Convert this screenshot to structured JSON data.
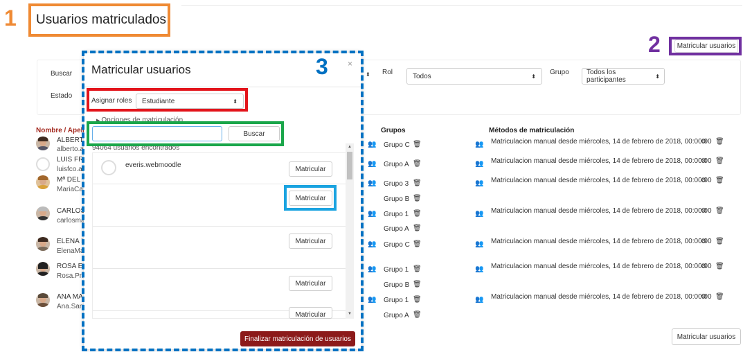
{
  "callouts": [
    "1",
    "2",
    "3"
  ],
  "page": {
    "title": "Usuarios matriculados"
  },
  "buttons": {
    "enrol_users_top": "Matricular usuarios",
    "enrol_users_bottom": "Matricular usuarios"
  },
  "filters": {
    "search_label": "Buscar",
    "status_label": "Estado",
    "role_label": "Rol",
    "role_value": "Todos",
    "group_label": "Grupo",
    "group_value": "Todos los participantes"
  },
  "table": {
    "headers": {
      "name": "Nombre / Apell",
      "groups": "Grupos",
      "methods": "Métodos de matriculación"
    },
    "rows": [
      {
        "name": "ALBERT",
        "email": "alberto.ar",
        "groups": [
          "Grupo C"
        ],
        "method": "Matriculacion manual desde miércoles, 14 de febrero de 2018, 00:00:00"
      },
      {
        "name": "LUIS FR",
        "email": "luisfco.ar",
        "groups": [
          "Grupo A"
        ],
        "method": "Matriculacion manual desde miércoles, 14 de febrero de 2018, 00:00:00"
      },
      {
        "name": "Mª DEL",
        "email": "MariaCa",
        "groups": [
          "Grupo 3",
          "Grupo B"
        ],
        "method": "Matriculacion manual desde miércoles, 14 de febrero de 2018, 00:00:00"
      },
      {
        "name": "CARLOS",
        "email": "carlosmai",
        "groups": [
          "Grupo 1",
          "Grupo A"
        ],
        "method": "Matriculacion manual desde miércoles, 14 de febrero de 2018, 00:00:00"
      },
      {
        "name": "ELENA I",
        "email": "ElenaMa",
        "groups": [
          "Grupo C"
        ],
        "method": "Matriculacion manual desde miércoles, 14 de febrero de 2018, 00:00:00"
      },
      {
        "name": "ROSA E",
        "email": "Rosa.Pn",
        "groups": [
          "Grupo 1",
          "Grupo B"
        ],
        "method": "Matriculacion manual desde miércoles, 14 de febrero de 2018, 00:00:00"
      },
      {
        "name": "ANA MA",
        "email": "Ana.San",
        "groups": [
          "Grupo 1",
          "Grupo A"
        ],
        "method": "Matriculacion manual desde miércoles, 14 de febrero de 2018, 00:00:00"
      }
    ]
  },
  "modal": {
    "title": "Matricular usuarios",
    "close": "×",
    "assign_roles_label": "Asignar roles",
    "assign_roles_value": "Estudiante",
    "enrol_options": "Opciones de matriculación",
    "search_value": "",
    "search_button": "Buscar",
    "found_count": "94064 usuarios encontrados",
    "users": [
      {
        "name": "everis.webmoodle",
        "button": "Matricular"
      },
      {
        "name": "",
        "button": "Matricular"
      },
      {
        "name": "",
        "button": "Matricular"
      },
      {
        "name": "",
        "button": "Matricular"
      },
      {
        "name": "",
        "button": "Matricular"
      }
    ],
    "finalize": "Finalizar matriculación de usuarios"
  },
  "icons": {
    "caret": "caret-updown-icon",
    "gear": "gear-icon",
    "trash": "trash-icon",
    "add_group": "add-group-icon",
    "people": "people-icon",
    "user": "user-icon"
  },
  "colors": {
    "callout1": "#ef8a34",
    "callout2": "#7030a0",
    "callout3": "#0071c2",
    "roles_box": "#e3141b",
    "search_box": "#1aa64a",
    "enrol_box": "#1aa3e0",
    "finalize_bg": "#8c1a1a",
    "header_red": "#a3281e"
  }
}
